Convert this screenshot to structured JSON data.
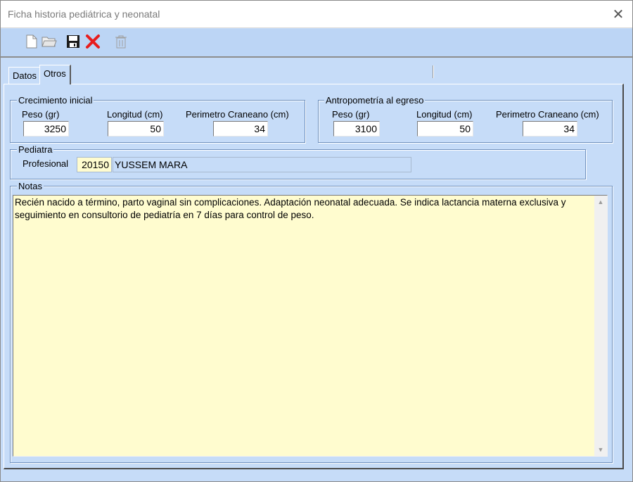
{
  "window": {
    "title": "Ficha historia pediátrica y neonatal"
  },
  "tabs": [
    {
      "label": "Datos"
    },
    {
      "label": "Otros"
    }
  ],
  "crecimiento": {
    "title": "Crecimiento inicial",
    "peso_label": "Peso (gr)",
    "peso": "3250",
    "longitud_label": "Longitud (cm)",
    "longitud": "50",
    "perimetro_label": "Perimetro Craneano (cm)",
    "perimetro": "34"
  },
  "antropometria": {
    "title": "Antropometría al egreso",
    "peso_label": "Peso (gr)",
    "peso": "3100",
    "longitud_label": "Longitud (cm)",
    "longitud": "50",
    "perimetro_label": "Perimetro Craneano (cm)",
    "perimetro": "34"
  },
  "pediatra": {
    "title": "Pediatra",
    "profesional_label": "Profesional",
    "codigo": "20150",
    "nombre": "YUSSEM MARA"
  },
  "notas": {
    "title": "Notas",
    "text": "Recién nacido a término, parto vaginal sin complicaciones. Adaptación neonatal adecuada. Se indica lactancia materna exclusiva y\nseguimiento en consultorio de pediatría en 7 días para control de peso."
  },
  "colors": {
    "window_bg": "#c6dcf8",
    "notes_bg": "#fffccf",
    "delete_red": "#e81c1c"
  }
}
